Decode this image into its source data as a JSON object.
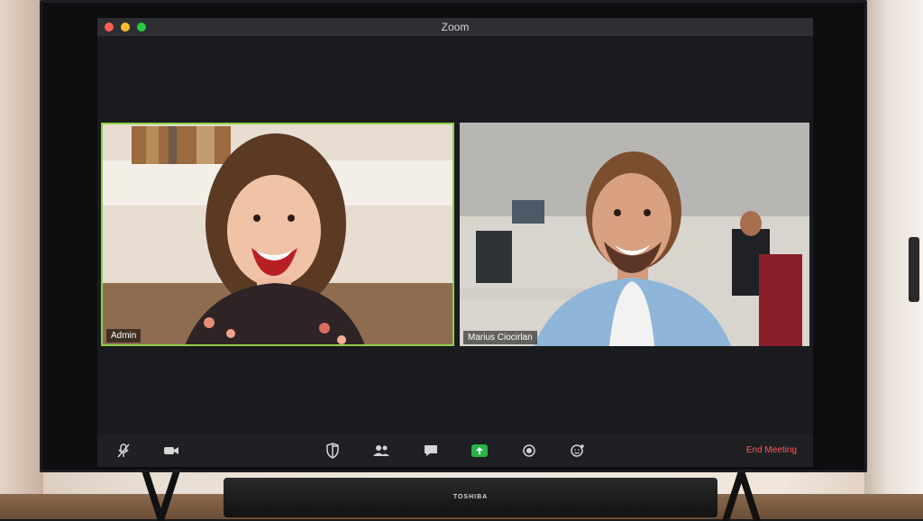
{
  "window": {
    "title": "Zoom"
  },
  "participants": [
    {
      "name": "Admin"
    },
    {
      "name": "Marius Ciocirlan"
    }
  ],
  "toolbar": {
    "end_meeting_label": "End Meeting"
  },
  "soundbar": {
    "brand": "TOSHIBA"
  },
  "colors": {
    "active_speaker_border": "#8ecf4a",
    "share_button": "#28b446",
    "end_meeting_text": "#ff5a5a"
  }
}
